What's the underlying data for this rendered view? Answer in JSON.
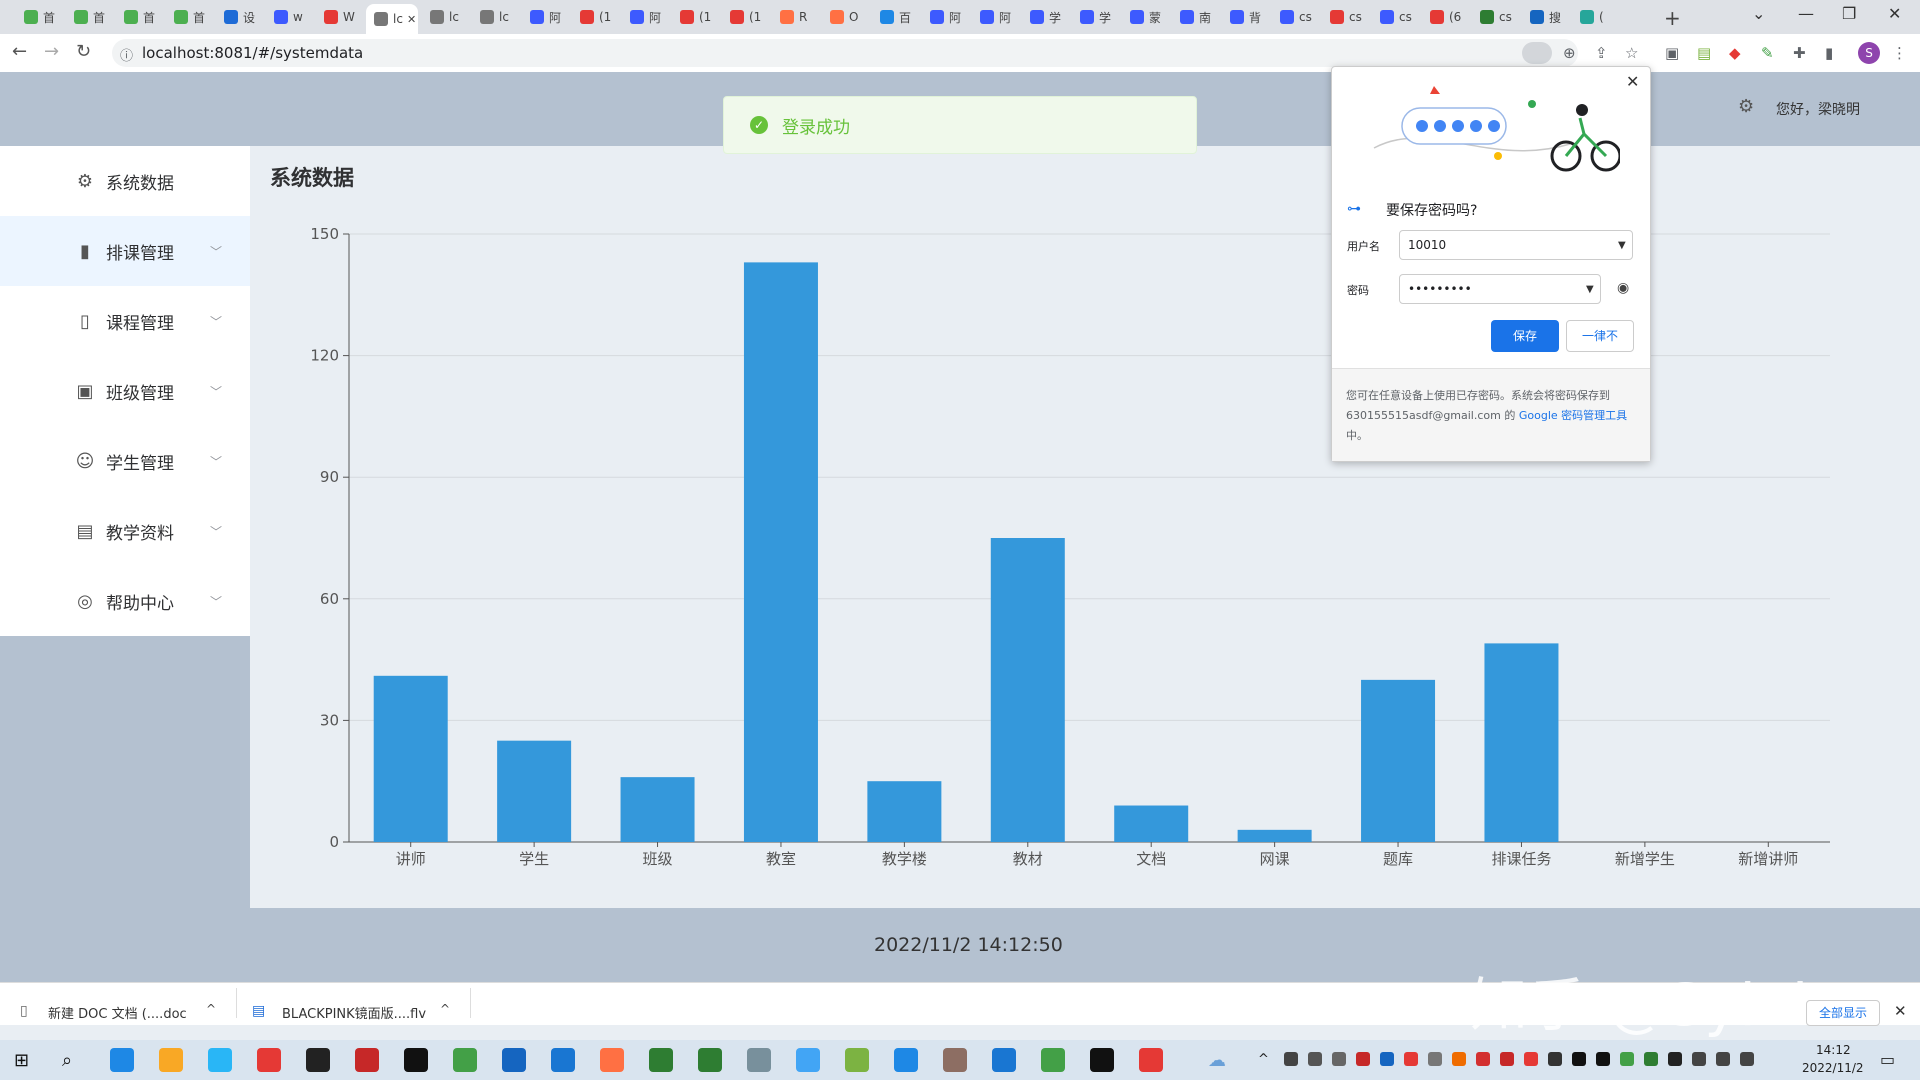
{
  "browser": {
    "tabs": [
      {
        "label": "首",
        "color": "#4caf50"
      },
      {
        "label": "首",
        "color": "#4caf50"
      },
      {
        "label": "首",
        "color": "#4caf50"
      },
      {
        "label": "首",
        "color": "#4caf50"
      },
      {
        "label": "设",
        "color": "#1e6bd6"
      },
      {
        "label": "w",
        "color": "#3d5afe"
      },
      {
        "label": "W",
        "color": "#e53935"
      },
      {
        "label": "lc",
        "color": "#777777"
      },
      {
        "label": "lc",
        "color": "#777777"
      },
      {
        "label": "lc",
        "color": "#777777"
      },
      {
        "label": "阿",
        "color": "#3d5afe"
      },
      {
        "label": "(1",
        "color": "#e53935"
      },
      {
        "label": "阿",
        "color": "#3d5afe"
      },
      {
        "label": "(1",
        "color": "#e53935"
      },
      {
        "label": "(1",
        "color": "#e53935"
      },
      {
        "label": "R",
        "color": "#ff7043"
      },
      {
        "label": "O",
        "color": "#ff7043"
      },
      {
        "label": "百",
        "color": "#1e88e5"
      },
      {
        "label": "阿",
        "color": "#3d5afe"
      },
      {
        "label": "阿",
        "color": "#3d5afe"
      },
      {
        "label": "学",
        "color": "#3d5afe"
      },
      {
        "label": "学",
        "color": "#3d5afe"
      },
      {
        "label": "蒙",
        "color": "#3d5afe"
      },
      {
        "label": "南",
        "color": "#3d5afe"
      },
      {
        "label": "背",
        "color": "#3d5afe"
      },
      {
        "label": "cs",
        "color": "#3d5afe"
      },
      {
        "label": "cs",
        "color": "#e53935"
      },
      {
        "label": "cs",
        "color": "#3d5afe"
      },
      {
        "label": "(6",
        "color": "#e53935"
      },
      {
        "label": "cs",
        "color": "#2e7d32"
      },
      {
        "label": "搜",
        "color": "#1565c0"
      },
      {
        "label": "(",
        "color": "#26a69a"
      }
    ],
    "active_tab_index": 7,
    "new_tab": "+",
    "url": "localhost:8081/#/systemdata"
  },
  "app": {
    "greeting": "您好，梁晓明",
    "page_title": "系统数据",
    "toast": "登录成功",
    "datetime": "2022/11/2 14:12:50",
    "menu": [
      {
        "label": "系统数据",
        "icon": "gear-icon",
        "glyph": "⚙",
        "has_arrow": false
      },
      {
        "label": "排课管理",
        "icon": "bar-chart-icon",
        "glyph": "▮",
        "has_arrow": true
      },
      {
        "label": "课程管理",
        "icon": "book-icon",
        "glyph": "▯",
        "has_arrow": true
      },
      {
        "label": "班级管理",
        "icon": "building-icon",
        "glyph": "▣",
        "has_arrow": true
      },
      {
        "label": "学生管理",
        "icon": "user-icon",
        "glyph": "☺",
        "has_arrow": true
      },
      {
        "label": "教学资料",
        "icon": "notebook-icon",
        "glyph": "▤",
        "has_arrow": true
      },
      {
        "label": "帮助中心",
        "icon": "help-icon",
        "glyph": "◎",
        "has_arrow": true
      }
    ],
    "active_menu_index": 1
  },
  "chart_data": {
    "type": "bar",
    "categories": [
      "讲师",
      "学生",
      "班级",
      "教室",
      "教学楼",
      "教材",
      "文档",
      "网课",
      "题库",
      "排课任务",
      "新增学生",
      "新增讲师"
    ],
    "values": [
      41,
      25,
      16,
      143,
      15,
      75,
      9,
      3,
      40,
      49,
      0,
      0
    ],
    "ylim": [
      0,
      150
    ],
    "yticks": [
      0,
      30,
      60,
      90,
      120,
      150
    ],
    "bar_color": "#3498db",
    "grid": true
  },
  "password_popup": {
    "title": "要保存密码吗?",
    "username_label": "用户名",
    "username_value": "10010",
    "password_label": "密码",
    "password_value": "•••••••••",
    "save_label": "保存",
    "never_label": "一律不",
    "footer_text": "您可在任意设备上使用已存密码。系统会将密码保存到 630155515asdf@gmail.com 的 ",
    "footer_link": "Google 密码管理工具",
    "footer_end": "中。"
  },
  "downloads": [
    {
      "name": "新建 DOC 文档 (....doc"
    },
    {
      "name": "BLACKPINK镜面版....flv"
    }
  ],
  "show_all": "全部显示",
  "watermark": "知乎 @Sylvia",
  "taskbar": {
    "time": "14:12",
    "date": "2022/11/2",
    "icons": [
      "#1e88e5",
      "#f9a825",
      "#29b6f6",
      "#e53935",
      "#222222",
      "#c62828",
      "#111111",
      "#43a047",
      "#1565c0",
      "#1976d2",
      "#ff7043",
      "#2e7d32",
      "#2e7d32",
      "#78909c",
      "#42a5f5",
      "#7cb342",
      "#1e88e5",
      "#8d6e63",
      "#1976d2",
      "#43a047",
      "#111111",
      "#e53935"
    ]
  }
}
